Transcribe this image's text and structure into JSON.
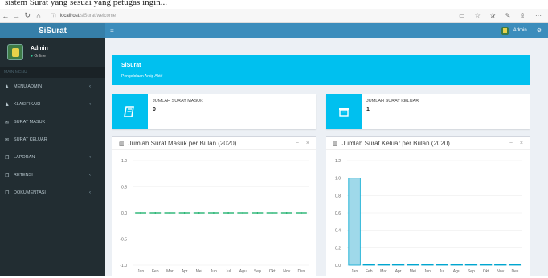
{
  "caption_text": "sistem Surat yang sesuai yang petugas ingin...",
  "browser": {
    "url_host": "localhost",
    "url_path": "/siSurat/welcome"
  },
  "sidebar": {
    "logo": "SiSurat",
    "user_name": "Admin",
    "user_status": "Online",
    "menu_header": "MAIN MENU",
    "items": [
      {
        "icon": "user-icon",
        "label": "MENU ADMIN",
        "has_submenu": true
      },
      {
        "icon": "user-icon",
        "label": "KLASIFIKASI",
        "has_submenu": true
      },
      {
        "icon": "envelope-icon",
        "label": "SURAT MASUK",
        "has_submenu": false
      },
      {
        "icon": "envelope-icon",
        "label": "SURAT KELUAR",
        "has_submenu": false
      },
      {
        "icon": "book-icon",
        "label": "LAPORAN",
        "has_submenu": true
      },
      {
        "icon": "book-icon",
        "label": "RETENSI",
        "has_submenu": true
      },
      {
        "icon": "book-icon",
        "label": "DOKUMENTASI",
        "has_submenu": true
      }
    ]
  },
  "topbar": {
    "user_name": "Admin"
  },
  "callout": {
    "title": "SiSurat",
    "subtitle": "Pengelolaan Arsip Aktif"
  },
  "infoboxes": [
    {
      "label": "JUMLAH SURAT MASUK",
      "value": "0",
      "icon": "book-icon"
    },
    {
      "label": "JUMLAH SURAT KELUAR",
      "value": "1",
      "icon": "archive-icon"
    }
  ],
  "colors": {
    "accent": "#00c0ef",
    "header": "#3c8dbc",
    "sidebar": "#222d32",
    "bar": "#00a7d0",
    "line": "#00a65a"
  },
  "chart_data": [
    {
      "type": "line",
      "title": "Jumlah Surat Masuk per Bulan (2020)",
      "categories": [
        "Jan",
        "Feb",
        "Mar",
        "Apr",
        "Mei",
        "Jun",
        "Jul",
        "Agu",
        "Sep",
        "Okt",
        "Nov",
        "Des"
      ],
      "values": [
        0,
        0,
        0,
        0,
        0,
        0,
        0,
        0,
        0,
        0,
        0,
        0
      ],
      "ylim": [
        -1.0,
        1.0
      ],
      "yticks": [
        "1.0",
        "0.5",
        "0.0",
        "-0.5",
        "-1.0"
      ],
      "style": "dashed",
      "grid": true
    },
    {
      "type": "bar",
      "title": "Jumlah Surat Keluar per Bulan (2020)",
      "categories": [
        "Jan",
        "Feb",
        "Mar",
        "Apr",
        "Mei",
        "Jun",
        "Jul",
        "Agu",
        "Sep",
        "Okt",
        "Nov",
        "Des"
      ],
      "values": [
        1,
        0,
        0,
        0,
        0,
        0,
        0,
        0,
        0,
        0,
        0,
        0
      ],
      "ylim": [
        0,
        1.2
      ],
      "yticks": [
        "1.2",
        "1.0",
        "0.8",
        "0.6",
        "0.4",
        "0.2",
        "0.0"
      ],
      "grid": true
    }
  ]
}
